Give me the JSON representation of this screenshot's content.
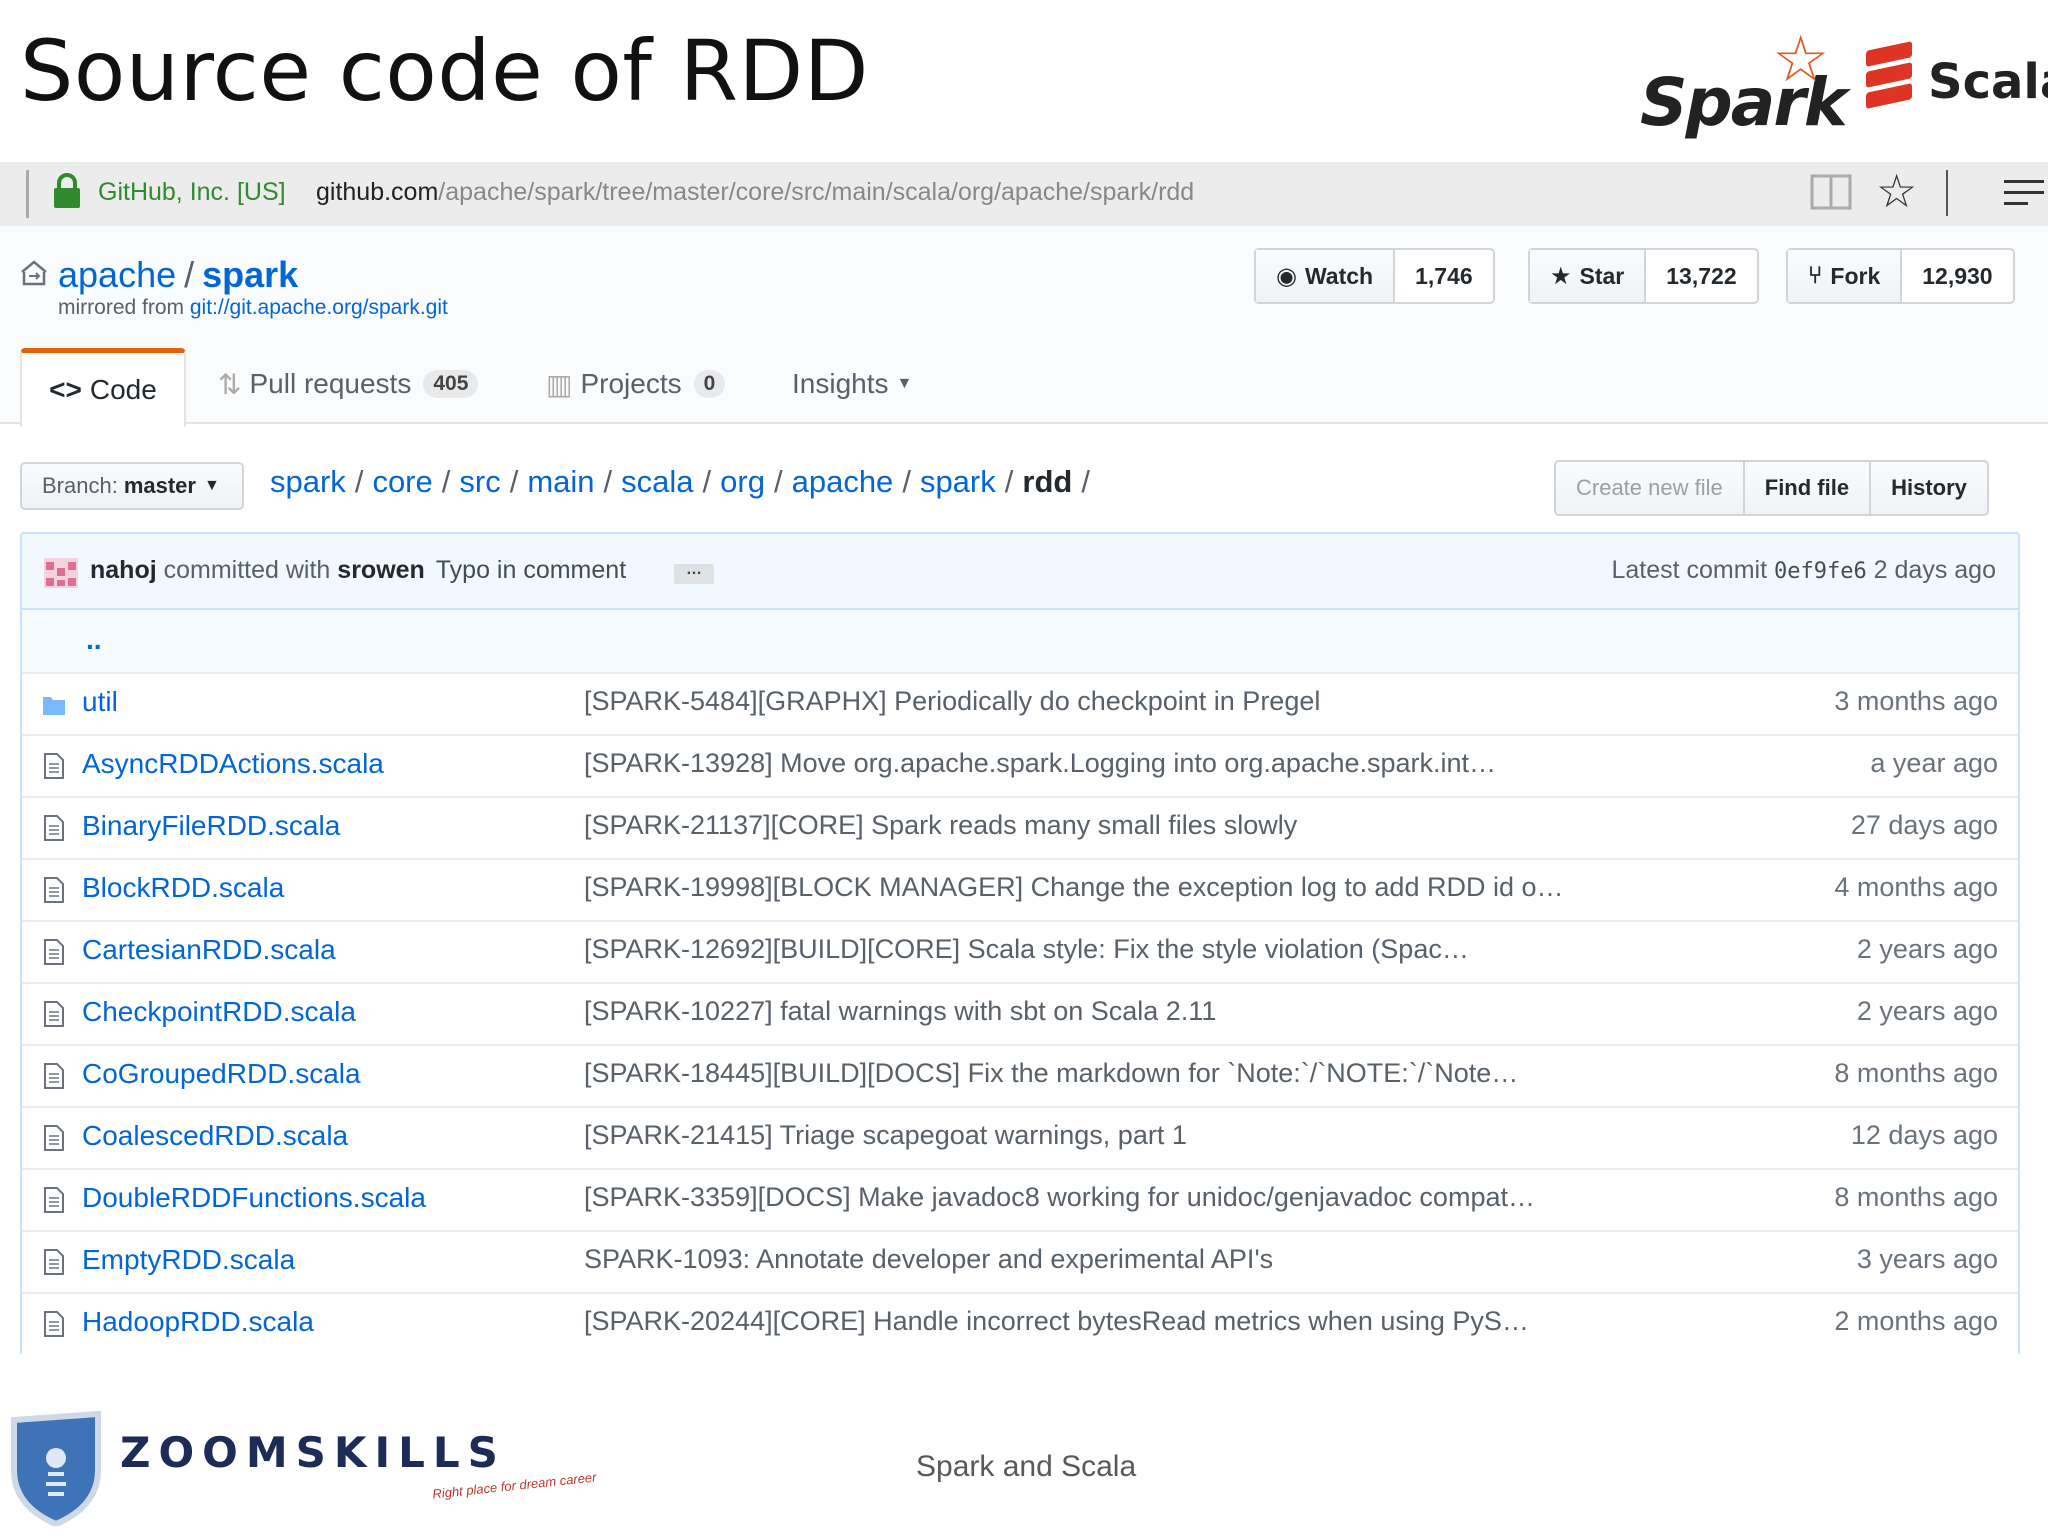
{
  "slide": {
    "title": "Source code of RDD",
    "footer": "Spark and Scala"
  },
  "logos": {
    "spark": "Spark",
    "scala": "Scala",
    "company": "ZOOMSKILLS",
    "tagline": "Right place for dream career"
  },
  "browser": {
    "org": "GitHub, Inc. [US]",
    "host": "github.com",
    "path": "/apache/spark/tree/master/core/src/main/scala/org/apache/spark/rdd"
  },
  "repo": {
    "owner": "apache",
    "name": "spark",
    "mirrored_label": "mirrored from",
    "mirrored_url": "git://git.apache.org/spark.git",
    "watch_label": "Watch",
    "watch_count": "1,746",
    "star_label": "Star",
    "star_count": "13,722",
    "fork_label": "Fork",
    "fork_count": "12,930"
  },
  "tabs": [
    {
      "label": "Code",
      "selected": true
    },
    {
      "label": "Pull requests",
      "count": "405"
    },
    {
      "label": "Projects",
      "count": "0"
    },
    {
      "label": "Insights"
    }
  ],
  "nav": {
    "branch_label": "Branch:",
    "branch": "master",
    "breadcrumbs": [
      "spark",
      "core",
      "src",
      "main",
      "scala",
      "org",
      "apache",
      "spark"
    ],
    "current": "rdd",
    "create_new_file": "Create new file",
    "find_file": "Find file",
    "history": "History"
  },
  "commit": {
    "author": "nahoj",
    "committed_with": "committed with",
    "committer": "srowen",
    "message": "Typo in comment",
    "ellipsis": "…",
    "latest_label": "Latest commit",
    "sha": "0ef9fe6",
    "age": "2 days ago"
  },
  "files": [
    {
      "type": "folder",
      "name": "util",
      "message": "[SPARK-5484][GRAPHX] Periodically do checkpoint in Pregel",
      "age": "3 months ago"
    },
    {
      "type": "file",
      "name": "AsyncRDDActions.scala",
      "message": "[SPARK-13928] Move org.apache.spark.Logging into org.apache.spark.int…",
      "age": "a year ago"
    },
    {
      "type": "file",
      "name": "BinaryFileRDD.scala",
      "message": "[SPARK-21137][CORE] Spark reads many small files slowly",
      "age": "27 days ago"
    },
    {
      "type": "file",
      "name": "BlockRDD.scala",
      "message": "[SPARK-19998][BLOCK MANAGER] Change the exception log to add RDD id o…",
      "age": "4 months ago"
    },
    {
      "type": "file",
      "name": "CartesianRDD.scala",
      "message": "[SPARK-12692][BUILD][CORE] Scala style: Fix the style violation (Spac…",
      "age": "2 years ago"
    },
    {
      "type": "file",
      "name": "CheckpointRDD.scala",
      "message": "[SPARK-10227] fatal warnings with sbt on Scala 2.11",
      "age": "2 years ago"
    },
    {
      "type": "file",
      "name": "CoGroupedRDD.scala",
      "message": "[SPARK-18445][BUILD][DOCS] Fix the markdown for `Note:`/`NOTE:`/`Note…",
      "age": "8 months ago"
    },
    {
      "type": "file",
      "name": "CoalescedRDD.scala",
      "message": "[SPARK-21415] Triage scapegoat warnings, part 1",
      "age": "12 days ago"
    },
    {
      "type": "file",
      "name": "DoubleRDDFunctions.scala",
      "message": "[SPARK-3359][DOCS] Make javadoc8 working for unidoc/genjavadoc compat…",
      "age": "8 months ago"
    },
    {
      "type": "file",
      "name": "EmptyRDD.scala",
      "message": "SPARK-1093: Annotate developer and experimental API's",
      "age": "3 years ago"
    },
    {
      "type": "file",
      "name": "HadoopRDD.scala",
      "message": "[SPARK-20244][CORE] Handle incorrect bytesRead metrics when using PyS…",
      "age": "2 months ago"
    }
  ],
  "up_dir": "..",
  "colors": {
    "link": "#0366d6",
    "tab_accent": "#e36209",
    "spark_orange": "#e25a1c",
    "scala_red": "#de3423"
  }
}
